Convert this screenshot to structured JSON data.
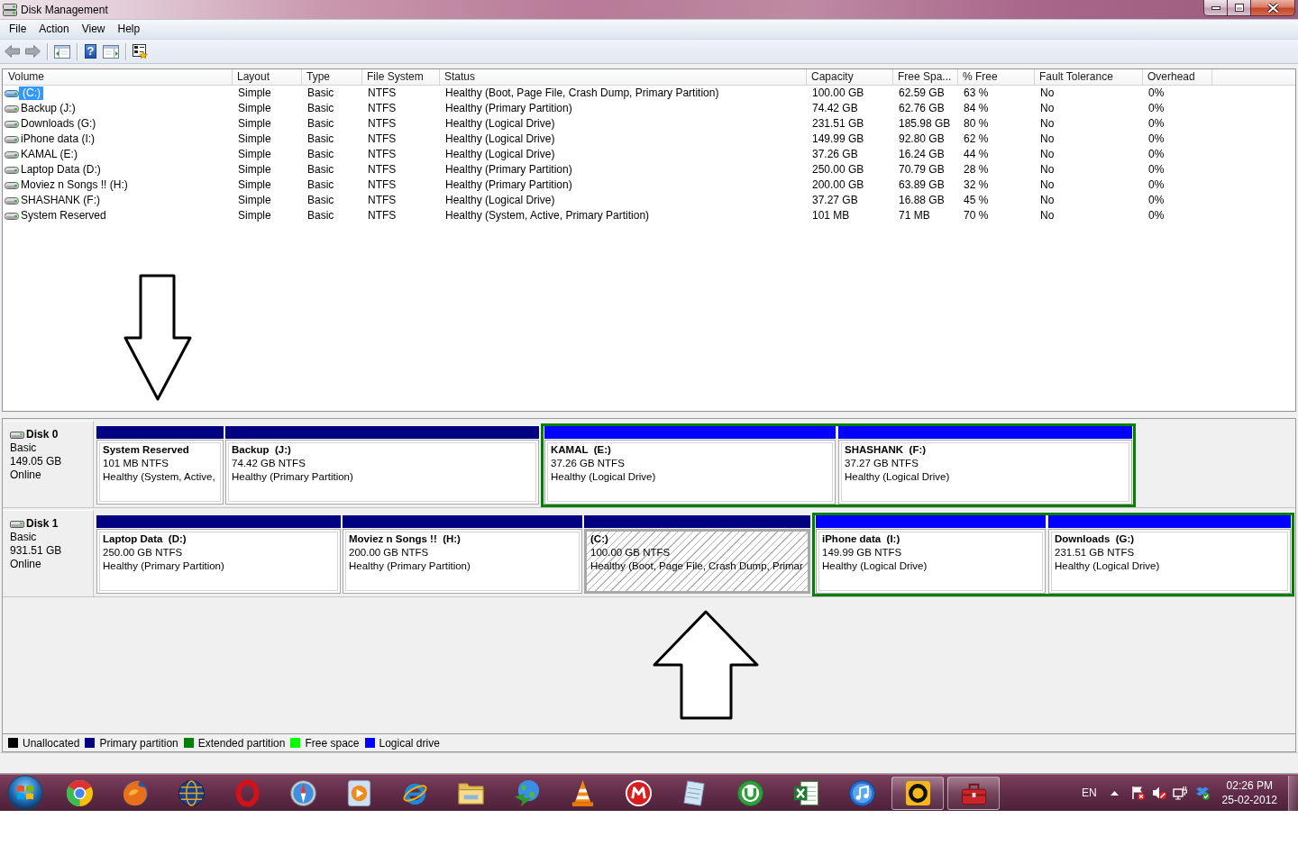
{
  "window": {
    "title": "Disk Management"
  },
  "menu": [
    "File",
    "Action",
    "View",
    "Help"
  ],
  "toolbar": [
    {
      "kind": "back"
    },
    {
      "kind": "forward"
    },
    {
      "kind": "separator"
    },
    {
      "kind": "console"
    },
    {
      "kind": "separator"
    },
    {
      "kind": "help",
      "glyph": "?"
    },
    {
      "kind": "actions"
    },
    {
      "kind": "separator"
    },
    {
      "kind": "properties"
    }
  ],
  "volume_table": {
    "columns": [
      "Volume",
      "Layout",
      "Type",
      "File System",
      "Status",
      "Capacity",
      "Free Spa...",
      "% Free",
      "Fault Tolerance",
      "Overhead"
    ],
    "rows": [
      {
        "selected": true,
        "cells": [
          "(C:)",
          "Simple",
          "Basic",
          "NTFS",
          "Healthy (Boot, Page File, Crash Dump, Primary Partition)",
          "100.00 GB",
          "62.59 GB",
          "63 %",
          "No",
          "0%"
        ]
      },
      {
        "selected": false,
        "cells": [
          "Backup (J:)",
          "Simple",
          "Basic",
          "NTFS",
          "Healthy (Primary Partition)",
          "74.42 GB",
          "62.76 GB",
          "84 %",
          "No",
          "0%"
        ]
      },
      {
        "selected": false,
        "cells": [
          "Downloads (G:)",
          "Simple",
          "Basic",
          "NTFS",
          "Healthy (Logical Drive)",
          "231.51 GB",
          "185.98 GB",
          "80 %",
          "No",
          "0%"
        ]
      },
      {
        "selected": false,
        "cells": [
          "iPhone data (I:)",
          "Simple",
          "Basic",
          "NTFS",
          "Healthy (Logical Drive)",
          "149.99 GB",
          "92.80 GB",
          "62 %",
          "No",
          "0%"
        ]
      },
      {
        "selected": false,
        "cells": [
          "KAMAL (E:)",
          "Simple",
          "Basic",
          "NTFS",
          "Healthy (Logical Drive)",
          "37.26 GB",
          "16.24 GB",
          "44 %",
          "No",
          "0%"
        ]
      },
      {
        "selected": false,
        "cells": [
          "Laptop Data (D:)",
          "Simple",
          "Basic",
          "NTFS",
          "Healthy (Primary Partition)",
          "250.00 GB",
          "70.79 GB",
          "28 %",
          "No",
          "0%"
        ]
      },
      {
        "selected": false,
        "cells": [
          "Moviez n Songs !! (H:)",
          "Simple",
          "Basic",
          "NTFS",
          "Healthy (Primary Partition)",
          "200.00 GB",
          "63.89 GB",
          "32 %",
          "No",
          "0%"
        ]
      },
      {
        "selected": false,
        "cells": [
          "SHASHANK (F:)",
          "Simple",
          "Basic",
          "NTFS",
          "Healthy (Logical Drive)",
          "37.27 GB",
          "16.88 GB",
          "45 %",
          "No",
          "0%"
        ]
      },
      {
        "selected": false,
        "cells": [
          "System Reserved",
          "Simple",
          "Basic",
          "NTFS",
          "Healthy (System, Active, Primary Partition)",
          "101 MB",
          "71 MB",
          "70 %",
          "No",
          "0%"
        ]
      }
    ]
  },
  "disks": [
    {
      "name": "Disk 0",
      "type": "Basic",
      "size": "149.05 GB",
      "status": "Online",
      "partitions": [
        {
          "kind": "primary",
          "selected": false,
          "name": "System Reserved",
          "size": "101 MB NTFS",
          "status": "Healthy (System, Active,"
        },
        {
          "kind": "primary",
          "selected": false,
          "name": "Backup  (J:)",
          "size": "74.42 GB NTFS",
          "status": "Healthy (Primary Partition)"
        },
        {
          "kind": "extended",
          "selected": false,
          "children": [
            {
              "kind": "logical",
              "selected": false,
              "name": "KAMAL  (E:)",
              "size": "37.26 GB NTFS",
              "status": "Healthy (Logical Drive)"
            },
            {
              "kind": "logical",
              "selected": false,
              "name": "SHASHANK  (F:)",
              "size": "37.27 GB NTFS",
              "status": "Healthy (Logical Drive)"
            }
          ]
        }
      ]
    },
    {
      "name": "Disk 1",
      "type": "Basic",
      "size": "931.51 GB",
      "status": "Online",
      "partitions": [
        {
          "kind": "primary",
          "selected": false,
          "name": "Laptop Data  (D:)",
          "size": "250.00 GB NTFS",
          "status": "Healthy (Primary Partition)"
        },
        {
          "kind": "primary",
          "selected": false,
          "name": "Moviez n Songs !!  (H:)",
          "size": "200.00 GB NTFS",
          "status": "Healthy (Primary Partition)"
        },
        {
          "kind": "primary",
          "selected": true,
          "name": "(C:)",
          "size": "100.00 GB NTFS",
          "status": "Healthy (Boot, Page File, Crash Dump, Primar"
        },
        {
          "kind": "extended",
          "selected": false,
          "children": [
            {
              "kind": "logical",
              "selected": false,
              "name": "iPhone data  (I:)",
              "size": "149.99 GB NTFS",
              "status": "Healthy (Logical Drive)"
            },
            {
              "kind": "logical",
              "selected": false,
              "name": "Downloads  (G:)",
              "size": "231.51 GB NTFS",
              "status": "Healthy (Logical Drive)"
            }
          ]
        }
      ]
    }
  ],
  "legend": [
    {
      "label": "Unallocated",
      "color": "#000000"
    },
    {
      "label": "Primary partition",
      "color": "#000080"
    },
    {
      "label": "Extended partition",
      "color": "#008000"
    },
    {
      "label": "Free space",
      "color": "#00ff00"
    },
    {
      "label": "Logical drive",
      "color": "#0000ff"
    }
  ],
  "taskbar": {
    "apps": [
      {
        "kind": "segring",
        "open": false
      },
      {
        "kind": "foxglobe",
        "open": false
      },
      {
        "kind": "netglobe",
        "open": false
      },
      {
        "kind": "ovalring",
        "open": false
      },
      {
        "kind": "compass",
        "open": false
      },
      {
        "kind": "playtile",
        "open": false
      },
      {
        "kind": "orbitring",
        "open": false
      },
      {
        "kind": "folder",
        "open": false
      },
      {
        "kind": "globearrow",
        "open": false
      },
      {
        "kind": "cone",
        "open": false
      },
      {
        "kind": "emblem",
        "open": false
      },
      {
        "kind": "notepad",
        "open": false
      },
      {
        "kind": "disc",
        "open": false
      },
      {
        "kind": "sheet",
        "open": false
      },
      {
        "kind": "note",
        "open": false
      },
      {
        "kind": "ringtile",
        "open": true
      },
      {
        "kind": "toolbox",
        "open": true
      }
    ],
    "tray": {
      "language": "EN",
      "alert": true,
      "volume_muted": true,
      "time": "02:26 PM",
      "date": "25-02-2012"
    }
  }
}
